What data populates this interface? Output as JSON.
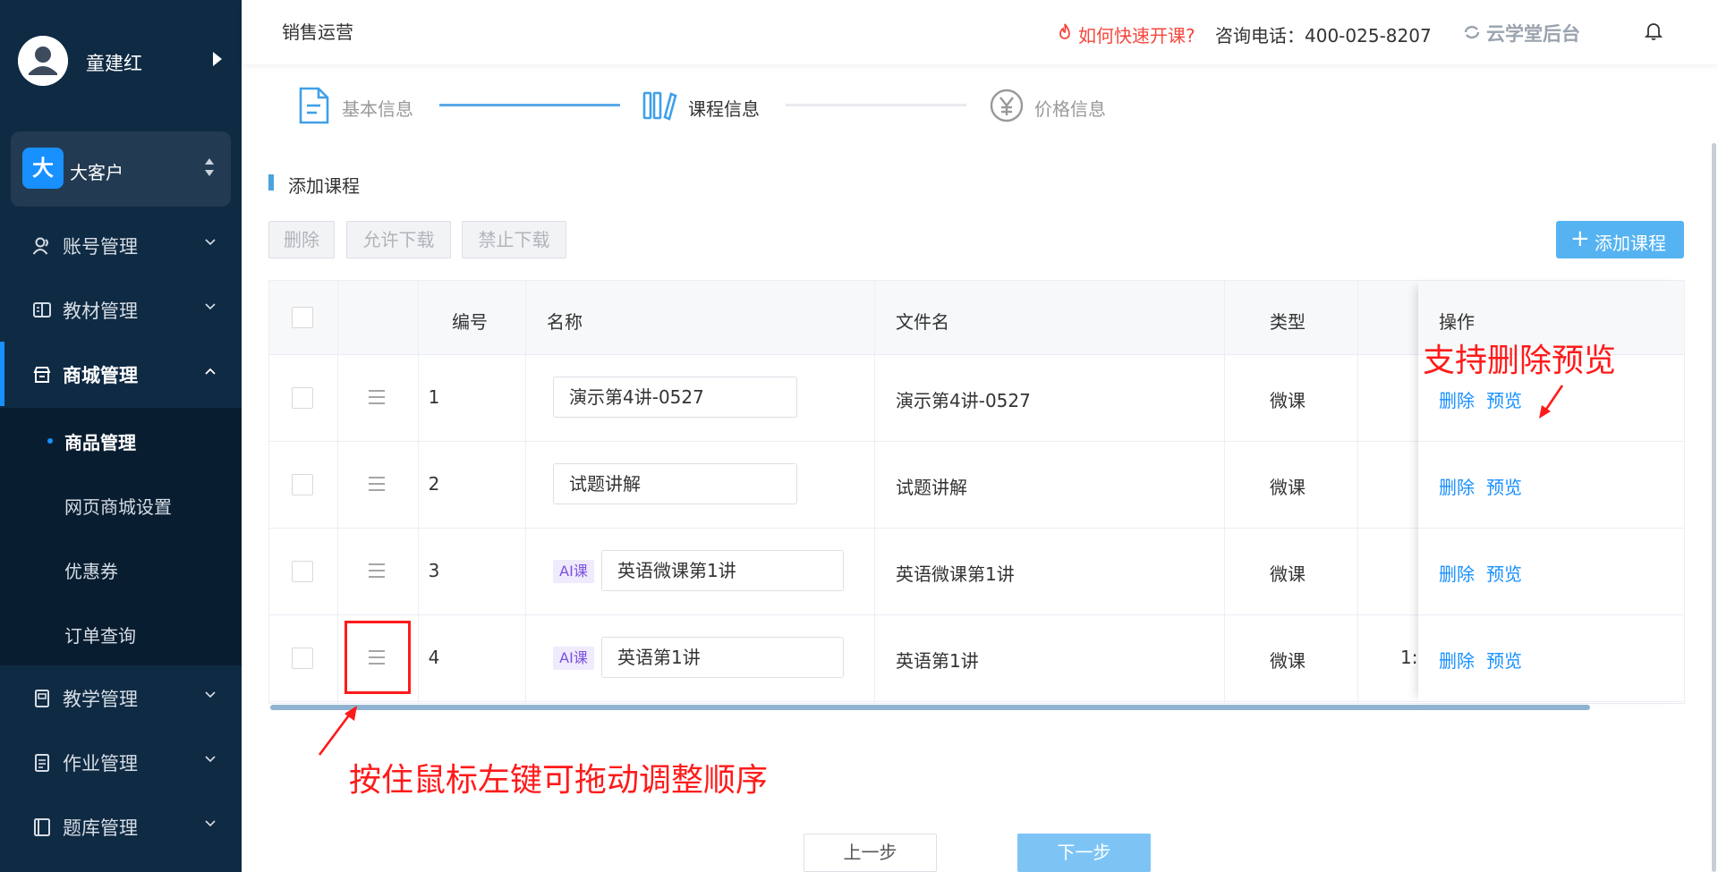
{
  "sidebar": {
    "user_name": "童建红",
    "org": {
      "badge": "大",
      "name": "大客户"
    },
    "nav": [
      {
        "label": "账号管理",
        "icon": "user-icon"
      },
      {
        "label": "教材管理",
        "icon": "book-icon"
      },
      {
        "label": "商城管理",
        "icon": "shop-icon"
      },
      {
        "label": "教学管理",
        "icon": "teaching-icon"
      },
      {
        "label": "作业管理",
        "icon": "homework-icon"
      },
      {
        "label": "题库管理",
        "icon": "question-bank-icon"
      }
    ],
    "sub_items": [
      {
        "label": "商品管理"
      },
      {
        "label": "网页商城设置"
      },
      {
        "label": "优惠券"
      },
      {
        "label": "订单查询"
      }
    ]
  },
  "header": {
    "title": "销售运营",
    "help_link": "如何快速开课?",
    "contact": "咨询电话：400-025-8207",
    "brand": "云学堂后台"
  },
  "steps": [
    {
      "label": "基本信息",
      "state": "done"
    },
    {
      "label": "课程信息",
      "state": "active"
    },
    {
      "label": "价格信息",
      "state": "pending"
    }
  ],
  "section": {
    "title": "添加课程"
  },
  "toolbar": {
    "delete_label": "删除",
    "allow_download_label": "允许下载",
    "forbid_download_label": "禁止下载",
    "add_course_label": "添加课程"
  },
  "table": {
    "headers": {
      "num": "编号",
      "name": "名称",
      "file": "文件名",
      "type": "类型",
      "ops": "操作"
    },
    "rows": [
      {
        "num": "1",
        "ai_tag": "",
        "name": "演示第4讲-0527",
        "file": "演示第4讲-0527",
        "type": "微课",
        "cut": ""
      },
      {
        "num": "2",
        "ai_tag": "",
        "name": "试题讲解",
        "file": "试题讲解",
        "type": "微课",
        "cut": ""
      },
      {
        "num": "3",
        "ai_tag": "AI课",
        "name": "英语微课第1讲",
        "file": "英语微课第1讲",
        "type": "微课",
        "cut": ""
      },
      {
        "num": "4",
        "ai_tag": "AI课",
        "name": "英语第1讲",
        "file": "英语第1讲",
        "type": "微课",
        "cut": "1:"
      }
    ],
    "op_delete": "删除",
    "op_preview": "预览"
  },
  "annotations": {
    "preview_note": "支持删除预览",
    "drag_note": "按住鼠标左键可拖动调整顺序"
  },
  "footer": {
    "prev_label": "上一步",
    "next_label": "下一步"
  },
  "colors": {
    "sidebar_bg": "#0f2a43",
    "accent": "#1890ff",
    "annotation": "#ff1a1a",
    "danger_link": "#f5463c"
  }
}
